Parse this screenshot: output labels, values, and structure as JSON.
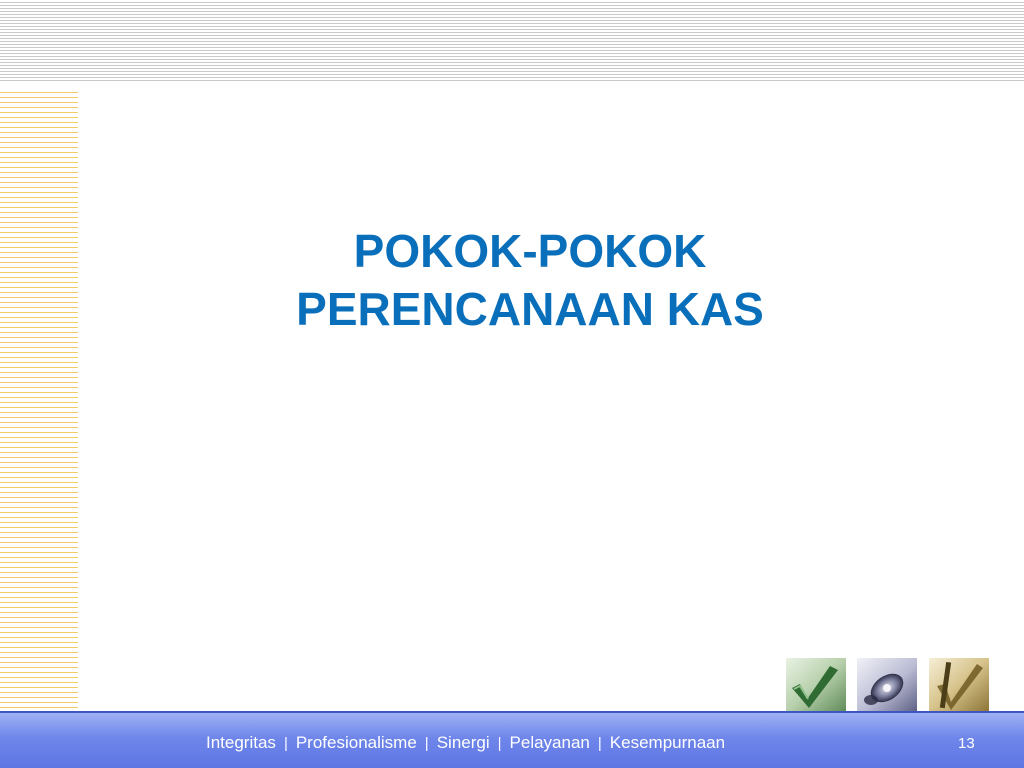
{
  "slide": {
    "title_lines": [
      "POKOK-POKOK",
      "PERENCANAAN KAS"
    ],
    "page_number": "13"
  },
  "footer": {
    "values": [
      "Integritas",
      "Profesionalisme",
      "Sinergi",
      "Pelayanan",
      "Kesempurnaan"
    ],
    "separator": "|"
  },
  "decor": {
    "tiles": [
      "checkmark-tile-icon",
      "disc-tile-icon",
      "pen-checkmark-tile-icon"
    ]
  },
  "colors": {
    "title": "#0a6fba",
    "footer_bar": "#6f86ea",
    "top_stripes": "#c9c9c9",
    "left_stripes": "#f3cc6a"
  }
}
